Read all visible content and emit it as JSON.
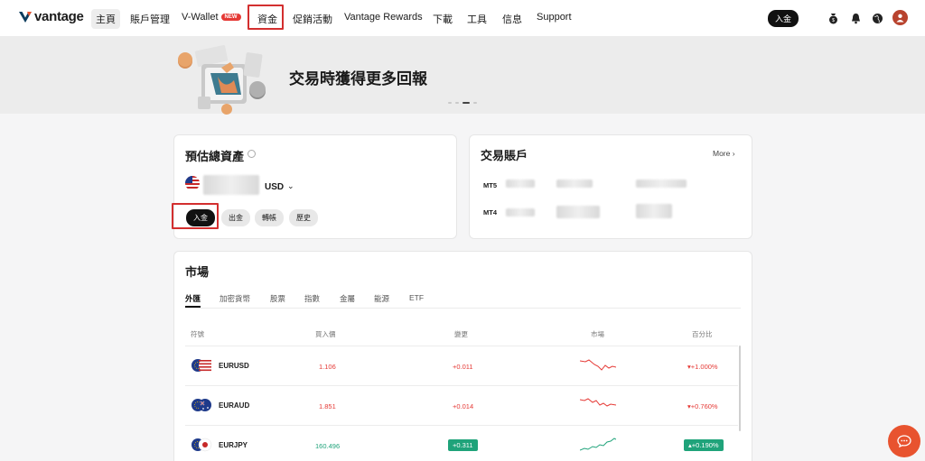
{
  "brand": {
    "logo_text": "vantage"
  },
  "nav": {
    "items": [
      "主頁",
      "賬戶管理",
      "V-Wallet",
      "資金",
      "促銷活動",
      "Vantage Rewards",
      "下載",
      "工具",
      "信息",
      "Support"
    ],
    "new_badge": "NEW",
    "deposit_button": "入金"
  },
  "banner": {
    "title": "交易時獲得更多回報",
    "dots": 4,
    "active_dot": 2
  },
  "assets": {
    "title": "預估總資產",
    "currency": "USD",
    "buttons": [
      "入金",
      "出金",
      "轉帳",
      "歷史"
    ]
  },
  "accounts": {
    "title": "交易賬戶",
    "more": "More",
    "rows": [
      "MT5",
      "MT4"
    ]
  },
  "market": {
    "title": "市場",
    "tabs": [
      "外匯",
      "加密貨幣",
      "股票",
      "指數",
      "金屬",
      "能源",
      "ETF"
    ],
    "headers": [
      "符號",
      "買入價",
      "變更",
      "市場",
      "百分比"
    ],
    "rows": [
      {
        "symbol": "EURUSD",
        "bid": "1.106",
        "change": "+0.011",
        "percent": "+1.000%",
        "direction": "down"
      },
      {
        "symbol": "EURAUD",
        "bid": "1.851",
        "change": "+0.014",
        "percent": "+0.760%",
        "direction": "down"
      },
      {
        "symbol": "EURJPY",
        "bid": "160.496",
        "change": "+0.311",
        "percent": "+0.190%",
        "direction": "up"
      }
    ]
  },
  "colors": {
    "accent_red": "#e53935",
    "up_green": "#1fa37a",
    "highlight": "#d32f2f"
  }
}
